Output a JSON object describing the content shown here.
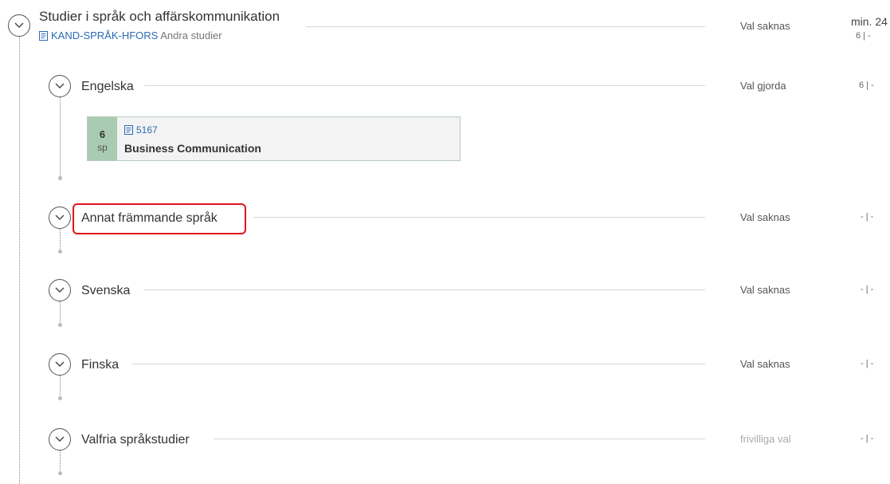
{
  "module": {
    "title": "Studier i språk och affärskommunikation",
    "code": "KAND-SPRÅK-HFORS",
    "category": "Andra studier",
    "status": "Val saknas",
    "credits_min": "min. 24",
    "credits_sel": "6 | -",
    "toggle_icon": "chevron-down-icon"
  },
  "groups": [
    {
      "title": "Engelska",
      "status": "Val gjorda",
      "credits": "6 | -",
      "courses": [
        {
          "credits": "6",
          "unit": "sp",
          "code": "5167",
          "name": "Business Communication"
        }
      ]
    },
    {
      "title": "Annat främmande språk",
      "status": "Val saknas",
      "credits": "- | -"
    },
    {
      "title": "Svenska",
      "status": "Val saknas",
      "credits": "- | -"
    },
    {
      "title": "Finska",
      "status": "Val saknas",
      "credits": "- | -"
    },
    {
      "title": "Valfria språkstudier",
      "status": "frivilliga val",
      "credits": "- | -"
    }
  ],
  "colors": {
    "link": "#2c6bb5",
    "course_credit_bg": "#a9cbb2",
    "highlight": "#e0141e"
  }
}
